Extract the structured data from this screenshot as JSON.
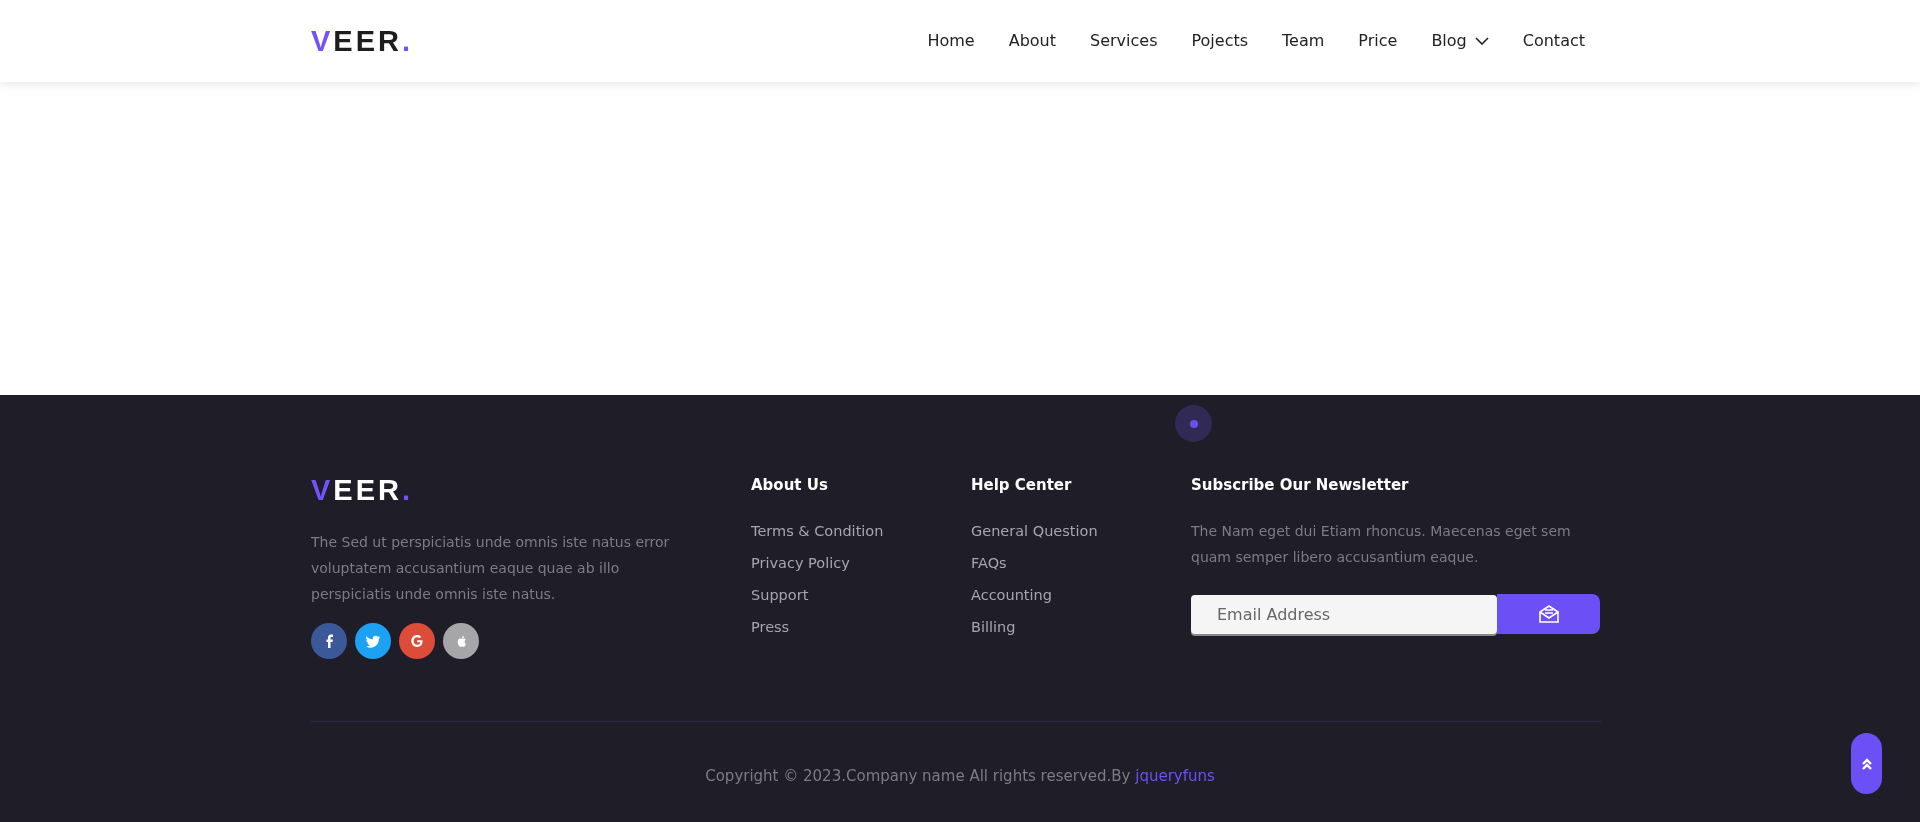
{
  "header": {
    "logo": {
      "mark": "V",
      "text": "EER",
      "dot": "."
    },
    "nav": [
      {
        "label": "Home",
        "dropdown": false
      },
      {
        "label": "About",
        "dropdown": false
      },
      {
        "label": "Services",
        "dropdown": false
      },
      {
        "label": "Pojects",
        "dropdown": false
      },
      {
        "label": "Team",
        "dropdown": false
      },
      {
        "label": "Price",
        "dropdown": false
      },
      {
        "label": "Blog",
        "dropdown": true
      },
      {
        "label": "Contact",
        "dropdown": false
      }
    ]
  },
  "footer": {
    "logo": {
      "mark": "V",
      "text": "EER",
      "dot": "."
    },
    "about_text": "The Sed ut perspiciatis unde omnis iste natus error voluptatem accusantium eaque quae ab illo perspiciatis unde omnis iste natus.",
    "social": [
      {
        "kind": "facebook",
        "color": "#3b5998"
      },
      {
        "kind": "twitter",
        "color": "#1da1f2"
      },
      {
        "kind": "google",
        "color": "#dd4b39"
      },
      {
        "kind": "apple",
        "color": "#a6a6a8"
      }
    ],
    "columns": [
      {
        "title": "About Us",
        "links": [
          "Terms & Condition",
          "Privacy Policy",
          "Support",
          "Press"
        ]
      },
      {
        "title": "Help Center",
        "links": [
          "General Question",
          "FAQs",
          "Accounting",
          "Billing"
        ]
      }
    ],
    "newsletter": {
      "title": "Subscribe Our Newsletter",
      "text": "The Nam eget dui Etiam rhoncus. Maecenas eget sem quam semper libero accusantium eaque.",
      "placeholder": "Email Address"
    },
    "copyright": {
      "text": "Copyright © 2023.Company name All rights reserved.By ",
      "link": "jqueryfuns"
    }
  }
}
